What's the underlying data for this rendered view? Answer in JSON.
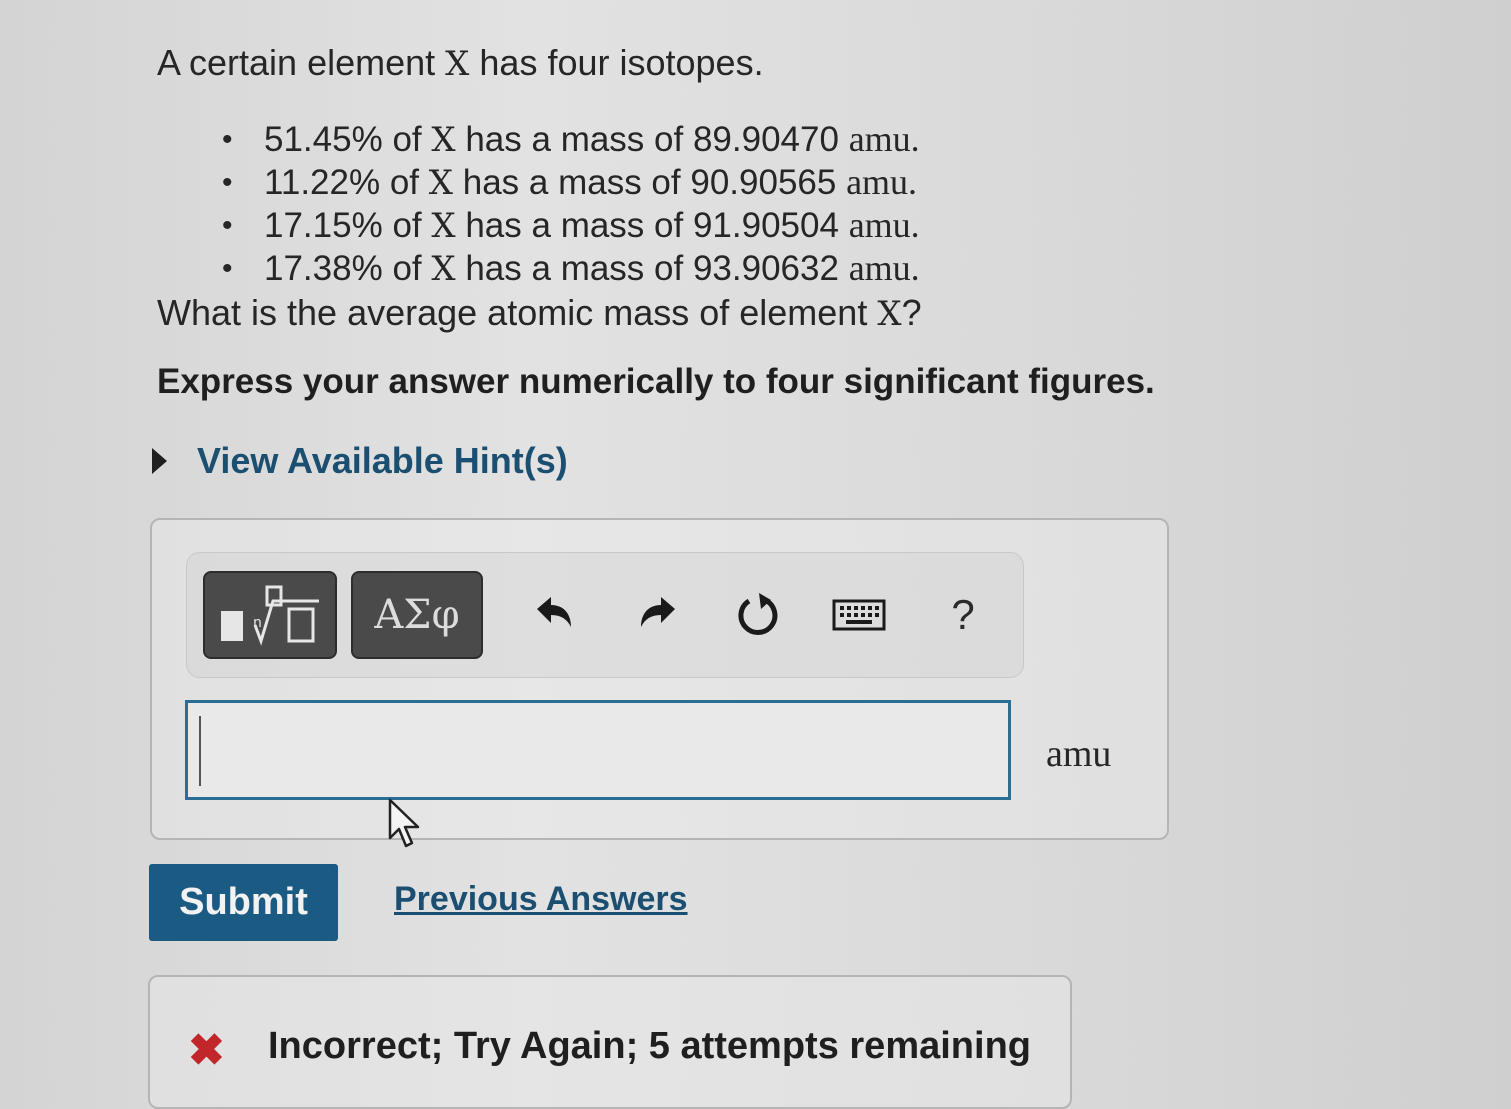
{
  "question": {
    "intro_pre": "A certain element",
    "element_symbol": "X",
    "intro_post": "has four isotopes.",
    "isotopes": [
      {
        "pct": "51.45%",
        "mass": "89.90470"
      },
      {
        "pct": "11.22%",
        "mass": "90.90565"
      },
      {
        "pct": "17.15%",
        "mass": "91.90504"
      },
      {
        "pct": "17.38%",
        "mass": "93.90632"
      }
    ],
    "of_text": "of",
    "has_mass_text": "has a mass of",
    "unit": "amu",
    "unit_with_period": "amu.",
    "prompt_pre": "What is the average atomic mass of element",
    "prompt_post": "?",
    "instruction": "Express your answer numerically to four significant figures."
  },
  "hints": {
    "label": "View Available Hint(s)"
  },
  "toolbar": {
    "greek_label": "ΑΣφ",
    "help_label": "?",
    "icons": [
      "template-icon",
      "undo-icon",
      "redo-icon",
      "reset-icon",
      "keyboard-icon",
      "help-icon"
    ]
  },
  "answer": {
    "value": "",
    "unit": "amu"
  },
  "actions": {
    "submit_label": "Submit",
    "previous_answers_label": "Previous Answers"
  },
  "feedback": {
    "icon": "x-mark-icon",
    "text": "Incorrect; Try Again; 5 attempts remaining",
    "color": "#c0262a"
  },
  "colors": {
    "accent": "#1a5a83",
    "link": "#1b4f72",
    "input_border": "#2a6e96"
  }
}
